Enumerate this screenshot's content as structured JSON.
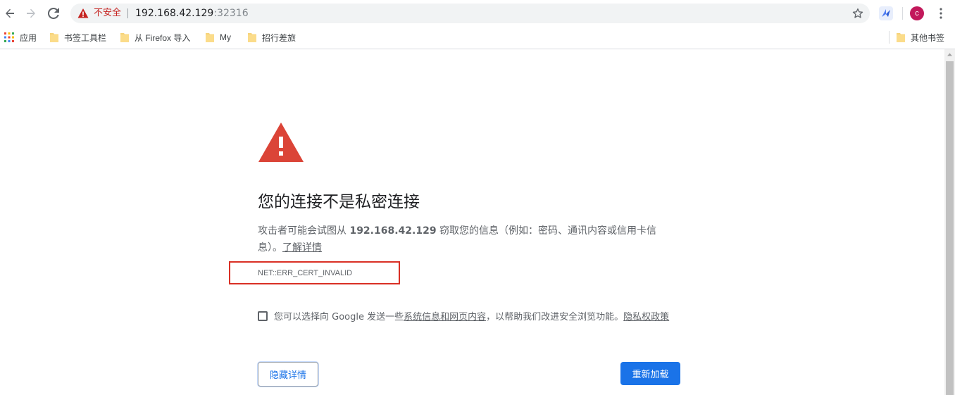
{
  "toolbar": {
    "security_label": "不安全",
    "url_host": "192.168.42.129",
    "url_port": ":32316",
    "avatar_letter": "c",
    "icons": [
      "back-icon",
      "forward-icon",
      "reload-icon",
      "warning-icon",
      "star-icon",
      "extension-icon",
      "menu-icon"
    ]
  },
  "bookmarks": {
    "apps_label": "应用",
    "items": [
      {
        "label": "书签工具栏"
      },
      {
        "label": "从 Firefox 导入"
      },
      {
        "label": "My"
      },
      {
        "label": "招行差旅"
      }
    ],
    "other_label": "其他书签"
  },
  "page": {
    "headline": "您的连接不是私密连接",
    "desc_prefix": "攻击者可能会试图从 ",
    "desc_host": "192.168.42.129",
    "desc_suffix": " 窃取您的信息（例如：密码、通讯内容或信用卡信息）。",
    "learn_more": "了解详情",
    "error_code": "NET::ERR_CERT_INVALID",
    "optin_prefix": "您可以选择向 Google 发送一些",
    "optin_link1": "系统信息和网页内容",
    "optin_mid": "，以帮助我们改进安全浏览功能。",
    "optin_link2": "隐私权政策",
    "optin_checked": false,
    "hide_details_button": "隐藏详情",
    "reload_button": "重新加载"
  },
  "colors": {
    "warning_red": "#db4437",
    "insecure_text": "#c5221f",
    "primary_blue": "#1a73e8",
    "highlight_box": "#d93025",
    "avatar": "#c2185b"
  }
}
